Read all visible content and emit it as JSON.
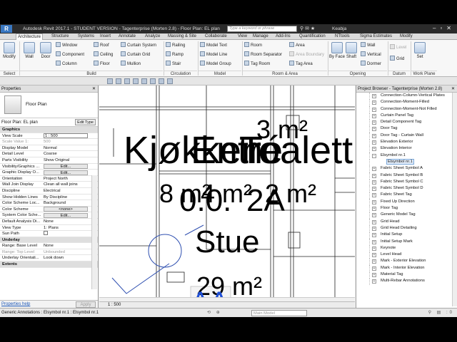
{
  "title_bar": {
    "logo": "R",
    "title": "Autodesk Revit 2017.1 - STUDENT VERSION -   Tagenterprise (Morten 2.8) - Floor Plan: EL plan",
    "search_placeholder": "Type a keyword or phrase",
    "user": "Keabja"
  },
  "ribbon_tabs": [
    "Architecture",
    "Structure",
    "Systems",
    "Insert",
    "Annotate",
    "Analyze",
    "Massing & Site",
    "Collaborate",
    "View",
    "Manage",
    "Add-Ins",
    "Quantification",
    "NTtools",
    "Sigma Estimates",
    "Modify"
  ],
  "ribbon": {
    "select": {
      "modify": "Modify",
      "label": "Select"
    },
    "build": {
      "wall": "Wall",
      "door": "Door",
      "window": "Window",
      "component": "Component",
      "column": "Column",
      "roof": "Roof",
      "ceiling": "Ceiling",
      "floor": "Floor",
      "curtain_system": "Curtain System",
      "curtain_grid": "Curtain Grid",
      "mullion": "Mullion",
      "label": "Build"
    },
    "circulation": {
      "railing": "Railing",
      "ramp": "Ramp",
      "stair": "Stair",
      "label": "Circulation"
    },
    "model": {
      "model_text": "Model Text",
      "model_line": "Model Line",
      "model_group": "Model Group",
      "label": "Model"
    },
    "room_area": {
      "room": "Room",
      "room_separator": "Room Separator",
      "tag_room": "Tag Room",
      "area": "Area",
      "area_boundary": "Area Boundary",
      "tag_area": "Tag Area",
      "label": "Room & Area"
    },
    "opening": {
      "by_face": "By Face",
      "shaft": "Shaft",
      "wall": "Wall",
      "vertical": "Vertical",
      "dormer": "Dormer",
      "label": "Opening"
    },
    "datum": {
      "level": "Level",
      "grid": "Grid",
      "label": "Datum"
    },
    "work_plane": {
      "set": "Set",
      "label": "Work Plane"
    }
  },
  "properties": {
    "title": "Properties",
    "type_name": "Floor Plan",
    "instance": "Floor Plan: EL plan",
    "edit_type": "Edit Type",
    "rows": [
      {
        "kind": "group",
        "label": "Graphics"
      },
      {
        "kind": "input",
        "label": "View Scale",
        "value": "1 : 500"
      },
      {
        "kind": "grey",
        "label": "Scale Value    1:",
        "value": "500"
      },
      {
        "kind": "text",
        "label": "Display Model",
        "value": "Normal"
      },
      {
        "kind": "text",
        "label": "Detail Level",
        "value": "Coarse"
      },
      {
        "kind": "text",
        "label": "Parts Visibility",
        "value": "Show Original"
      },
      {
        "kind": "btn",
        "label": "Visibility/Graphics ...",
        "value": "Edit..."
      },
      {
        "kind": "btn",
        "label": "Graphic Display O...",
        "value": "Edit..."
      },
      {
        "kind": "text",
        "label": "Orientation",
        "value": "Project North"
      },
      {
        "kind": "text",
        "label": "Wall Join Display",
        "value": "Clean all wall joins"
      },
      {
        "kind": "text",
        "label": "Discipline",
        "value": "Electrical"
      },
      {
        "kind": "text",
        "label": "Show Hidden Lines",
        "value": "By Discipline"
      },
      {
        "kind": "text",
        "label": "Color Scheme Loc...",
        "value": "Background"
      },
      {
        "kind": "btn",
        "label": "Color Scheme",
        "value": "<none>"
      },
      {
        "kind": "btn",
        "label": "System Color Sche...",
        "value": "Edit..."
      },
      {
        "kind": "text",
        "label": "Default Analysis Di...",
        "value": "None"
      },
      {
        "kind": "text",
        "label": "View Type",
        "value": "1: Plans"
      },
      {
        "kind": "check",
        "label": "Sun Path",
        "value": ""
      },
      {
        "kind": "group",
        "label": "Underlay"
      },
      {
        "kind": "text",
        "label": "Range: Base Level",
        "value": "None"
      },
      {
        "kind": "grey",
        "label": "Range: Top Level",
        "value": "Unbounded"
      },
      {
        "kind": "text",
        "label": "Underlay Orientati...",
        "value": "Look down"
      },
      {
        "kind": "group",
        "label": "Extents"
      }
    ],
    "help": "Properties help",
    "apply": "Apply"
  },
  "canvas": {
    "labels": {
      "kokken": "Kjøkken",
      "entre": "Entré",
      "toalett": "Toalett",
      "area_top": "3 m²",
      "area_8": "8 m²",
      "area_4": "4 m²",
      "area_2": "2 m²",
      "num_00": "0.0.",
      "num_2a": "2A",
      "stue": "Stue",
      "area_29": "29 m²",
      "tag_aa": "AA"
    },
    "scale": "1 : 500"
  },
  "browser": {
    "title": "Project Browser - Tagenterprise (Morten 2.8)",
    "items": [
      "Connection-Column-Vertical Plates",
      "Connection-Moment-Filled",
      "Connection-Moment-Not Filled",
      "Curtain Panel Tag",
      "Detail Component Tag",
      "Door Tag",
      "Door Tag - Curtain Wall",
      "Elevation Exterior",
      "Elevation Interior",
      "Elsymbol nr.1",
      "Elsymbol nr.1",
      "Fabric Sheet Symbol A",
      "Fabric Sheet Symbol B",
      "Fabric Sheet Symbol C",
      "Fabric Sheet Symbol D",
      "Fabric Sheet Tag",
      "Fixed Up Direction",
      "Floor Tag",
      "Generic Model Tag",
      "Grid Head",
      "Grid Head Detailing",
      "Initial Setup",
      "Initial Setup Mark",
      "Keynote",
      "Level Head",
      "Mark - Exterior Elevation",
      "Mark - Interior Elevation",
      "Material Tag",
      "Multi-Rebar Annotations"
    ]
  },
  "status": {
    "text": "Generic Annotations : Elsymbol nr.1 : Elsymbol nr.1",
    "model": "Main Model",
    "filter_count": ":0"
  },
  "colors": {
    "tag_blue": "#1f4fd6",
    "plan_line": "#222222",
    "symbol_blue": "#2e4fb0"
  }
}
